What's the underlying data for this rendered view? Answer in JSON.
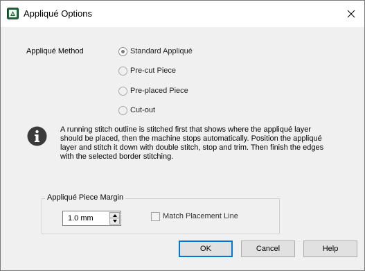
{
  "window": {
    "title": "Appliqué Options",
    "icon": "applique-app-icon",
    "close_icon": "close-icon"
  },
  "method": {
    "label": "Appliqué Method",
    "options": [
      {
        "label": "Standard Appliqué",
        "selected": true
      },
      {
        "label": "Pre-cut Piece",
        "selected": false
      },
      {
        "label": "Pre-placed Piece",
        "selected": false
      },
      {
        "label": "Cut-out",
        "selected": false
      }
    ]
  },
  "info": {
    "icon": "info-icon",
    "lines": [
      "A running stitch outline is stitched first that shows where the appliqué layer",
      "should be placed, then the machine stops automatically. Position the appliqué",
      "layer and stitch it down with double stitch, stop and trim. Then finish the edges",
      "with the selected border stitching."
    ]
  },
  "margin": {
    "group_label": "Appliqué Piece Margin",
    "value": "1.0 mm",
    "match_placement_label": "Match Placement Line",
    "match_placement_checked": false
  },
  "buttons": {
    "ok": "OK",
    "cancel": "Cancel",
    "help": "Help"
  }
}
